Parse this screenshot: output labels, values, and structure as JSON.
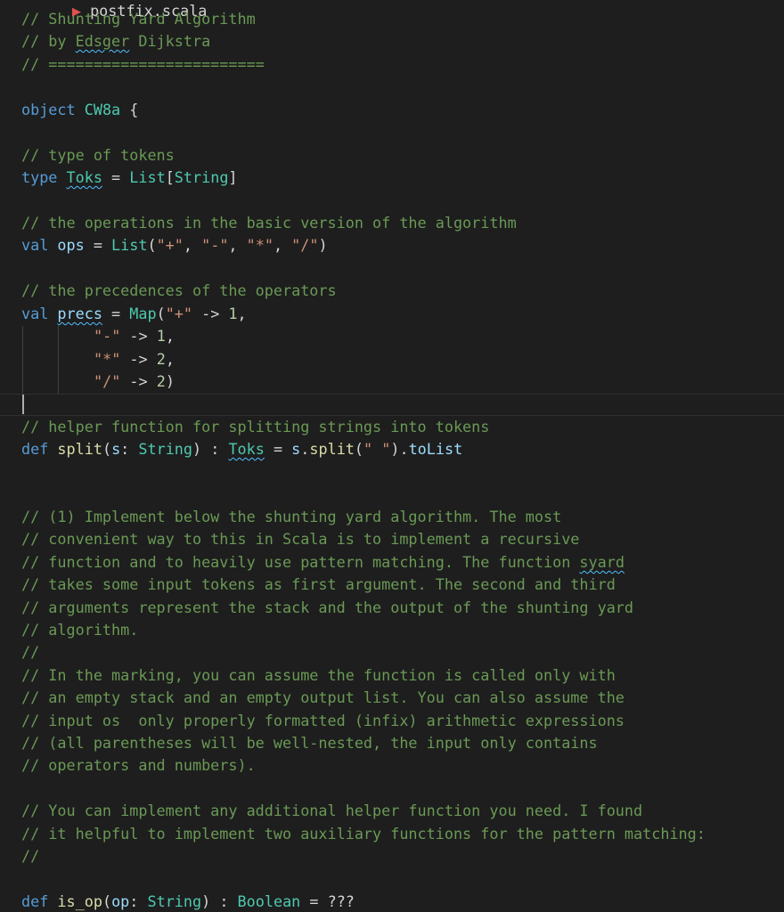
{
  "colors": {
    "background": "#1e1e1e",
    "comment": "#6a9955",
    "keyword": "#569cd6",
    "type": "#4ec9b0",
    "identifier": "#9cdcfe",
    "function": "#dcdcaa",
    "string": "#ce9178",
    "number": "#b5cea8",
    "squiggle": "#4fc1ff"
  },
  "header_fragment": "postfix.scala",
  "code": {
    "l1": "// Shunting Yard Algorithm",
    "l2a": "// by ",
    "l2b": "Edsger",
    "l2c": " Dijkstra",
    "l3": "// ========================",
    "l5": [
      "object",
      " ",
      "CW8a",
      " {"
    ],
    "l7": "// type of tokens",
    "l8": [
      "type",
      " ",
      "Toks",
      " = ",
      "List",
      "[",
      "String",
      "]"
    ],
    "l10": "// the operations in the basic version of the algorithm",
    "l11": [
      "val",
      " ",
      "ops",
      " = ",
      "List",
      "(",
      "\"+\"",
      ", ",
      "\"-\"",
      ", ",
      "\"*\"",
      ", ",
      "\"/\"",
      ")"
    ],
    "l13": "// the precedences of the operators",
    "l14": [
      "val",
      " ",
      "precs",
      " = ",
      "Map",
      "(",
      "\"+\"",
      " -> ",
      "1",
      ","
    ],
    "l15": [
      "\"-\"",
      " -> ",
      "1",
      ","
    ],
    "l16": [
      "\"*\"",
      " -> ",
      "2",
      ","
    ],
    "l17": [
      "\"/\"",
      " -> ",
      "2",
      ")"
    ],
    "l19": "// helper function for splitting strings into tokens",
    "l20": [
      "def",
      " ",
      "split",
      "(",
      "s",
      ": ",
      "String",
      ") : ",
      "Toks",
      " = ",
      "s",
      ".",
      "split",
      "(",
      "\" \"",
      ").",
      "toList"
    ],
    "l23": "// (1) Implement below the shunting yard algorithm. The most",
    "l24": "// convenient way to this in Scala is to implement a recursive",
    "l25a": "// function and to heavily use pattern matching. The function ",
    "l25b": "syard",
    "l26": "// takes some input tokens as first argument. The second and third",
    "l27": "// arguments represent the stack and the output of the shunting yard",
    "l28": "// algorithm.",
    "l29": "//",
    "l30": "// In the marking, you can assume the function is called only with",
    "l31": "// an empty stack and an empty output list. You can also assume the",
    "l32": "// input os  only properly formatted (infix) arithmetic expressions",
    "l33": "// (all parentheses will be well-nested, the input only contains",
    "l34": "// operators and numbers).",
    "l36": "// You can implement any additional helper function you need. I found",
    "l37": "// it helpful to implement two auxiliary functions for the pattern matching:",
    "l38": "//",
    "l40": [
      "def",
      " ",
      "is_op",
      "(",
      "op",
      ": ",
      "String",
      ") : ",
      "Boolean",
      " = ",
      "???"
    ]
  }
}
